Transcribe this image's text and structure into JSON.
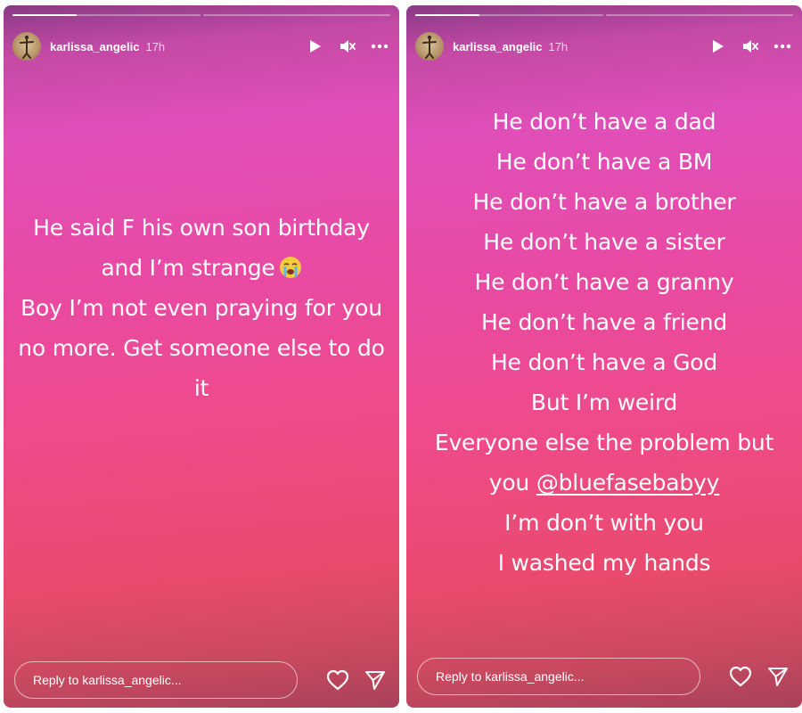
{
  "stories": [
    {
      "username": "karlissa_angelic",
      "time": "17h",
      "progress": [
        1,
        0
      ],
      "caption_lines": [
        "He said F his own son birthday",
        "and I’m strange",
        "Boy I’m not even praying for you",
        "no more. Get someone else to do",
        "it"
      ],
      "caption_emoji": "loudly-crying-face-emoji",
      "reply_placeholder": "Reply to karlissa_angelic...",
      "icons": {
        "play": "play-icon",
        "mute": "mute-icon",
        "more": "more-icon",
        "like": "heart-icon",
        "send": "send-icon"
      }
    },
    {
      "username": "karlissa_angelic",
      "time": "17h",
      "progress": [
        1,
        0
      ],
      "caption_lines": [
        "He don’t have a dad",
        "He don’t have a BM",
        "He don’t have a brother",
        "He don’t have a sister",
        "He don’t have a granny",
        "He don’t have a friend",
        "He don’t have a God",
        "But I’m weird",
        "Everyone else the problem but",
        "you",
        "I’m don’t with you",
        "I washed my hands"
      ],
      "mention": "@bluefasebabyy",
      "reply_placeholder": "Reply to karlissa_angelic...",
      "icons": {
        "play": "play-icon",
        "mute": "mute-icon",
        "more": "more-icon",
        "like": "heart-icon",
        "send": "send-icon"
      }
    }
  ],
  "colors": {
    "gradient_top": "#8a3a86",
    "gradient_mid": "#e84aa4",
    "gradient_bottom": "#ea4a6d",
    "text": "#ffffff"
  }
}
